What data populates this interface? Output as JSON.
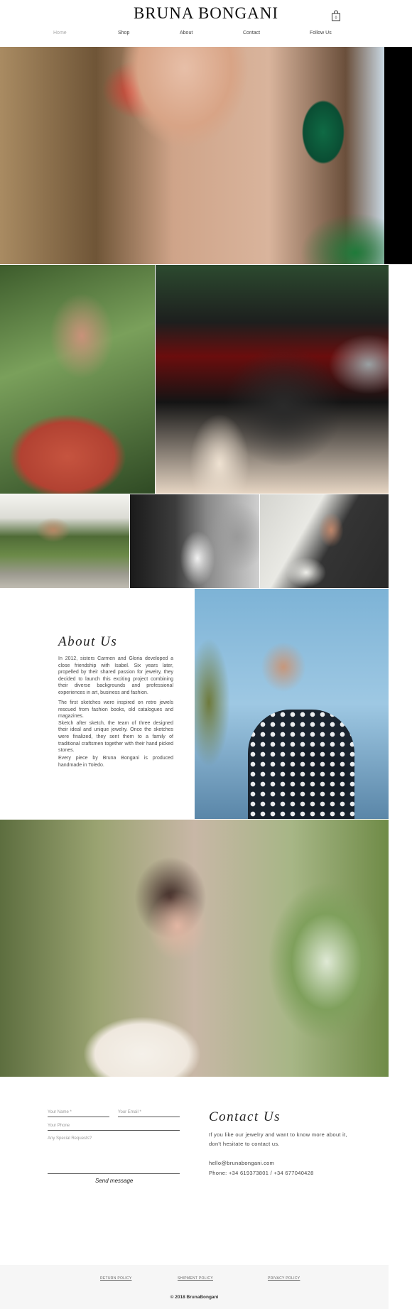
{
  "header": {
    "brand": "BRUNA BONGANI",
    "cart_count": "0",
    "cart_icon": "shopping-bag-icon",
    "nav": [
      "Home",
      "Shop",
      "About",
      "Contact",
      "Follow Us"
    ],
    "active_nav": "Home"
  },
  "about": {
    "title": "About Us",
    "paragraph_1": "In 2012, sisters Carmen and Gloria developed a close friendship with Isabel. Six years later, propelled by their shared passion for jewelry, they decided to launch this exciting project combining their diverse backgrounds and professional experiences in art, business and fashion.",
    "paragraph_2": "The first sketches were inspired on retro jewels rescued from fashion books, old catalogues and magazines.\nSketch after sketch, the team of three designed their ideal and unique jewelry. Once the sketches were finalized, they sent them to a family of traditional craftsmen together with their hand picked stones.",
    "paragraph_3": "Every piece by Bruna Bongani is produced handmade in Toledo."
  },
  "form": {
    "name_placeholder": "Your Name *",
    "email_placeholder": "Your Email *",
    "phone_placeholder": "Your Phone",
    "requests_placeholder": "Any Special Requests?",
    "send_label": "Send message"
  },
  "contact": {
    "title": "Contact Us",
    "intro": "If you like our jewelry and want to know more about it, don't hesitate to contact us.",
    "email": "hello@brunabongani.com",
    "phone": "Phone: +34 619373801 / +34 677040428"
  },
  "footer": {
    "return_policy": "RETURN POLICY",
    "shipment_policy": "SHIPMENT POLICY",
    "privacy_policy": "PRIVACY POLICY",
    "copyright": "© 2018 BrunaBongani"
  },
  "colors": {
    "background": "#ffffff",
    "text": "#222222",
    "footer_bg": "#f6f6f6",
    "hero_side_bar": "#000000"
  }
}
